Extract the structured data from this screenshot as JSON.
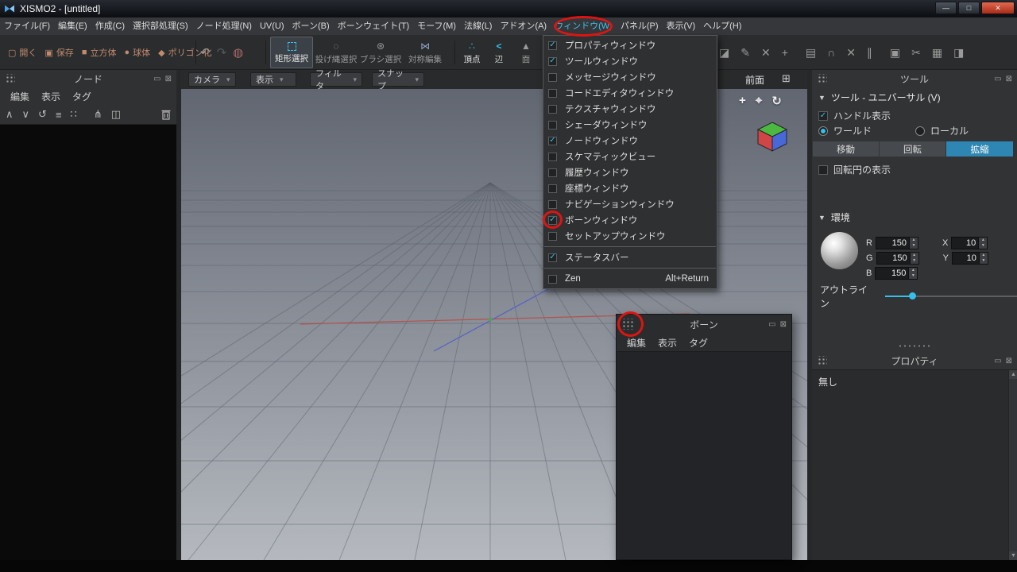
{
  "colors": {
    "accent": "#35c0ea",
    "annotation": "#dd1512"
  },
  "icons": {
    "open": "▢",
    "save": "▣",
    "cube": "■",
    "sphere": "●",
    "polygonize": "◆",
    "undo": "↶",
    "redo": "↷",
    "palette": "◍",
    "lasso": "◌",
    "brush": "⊛",
    "symmetry": "⋈",
    "vertex": "∴",
    "edge": "<",
    "face": "▲",
    "eraser": "◪",
    "pencil": "✎",
    "cross": "✕",
    "merge": "+",
    "document": "▤",
    "magnet": "∩",
    "remove": "✕",
    "mirror": "∥",
    "lock": "▣",
    "knife": "✂",
    "image": "▦",
    "stamp": "◨",
    "chevron": "▾",
    "section": "▼",
    "up": "∧",
    "down": "∨",
    "refresh": "↺",
    "list": "≡",
    "grid": "∷",
    "hierarchy": "⋔",
    "box": "◫",
    "win_min": "—",
    "win_max": "□",
    "win_close": "✕",
    "panel_min": "▭",
    "panel_close": "⊠",
    "pan": "+",
    "magnify": "⌖",
    "orbit": "↻",
    "projection": "⊞",
    "spin_up": "▲",
    "spin_down": "▼",
    "check": "✓"
  },
  "window": {
    "title": "XISMO2 - [untitled]"
  },
  "menubar": {
    "items": [
      {
        "label": "ファイル(F)"
      },
      {
        "label": "編集(E)"
      },
      {
        "label": "作成(C)"
      },
      {
        "label": "選択部処理(S)"
      },
      {
        "label": "ノード処理(N)"
      },
      {
        "label": "UV(U)"
      },
      {
        "label": "ボーン(B)"
      },
      {
        "label": "ボーンウェイト(T)"
      },
      {
        "label": "モーフ(M)"
      },
      {
        "label": "法線(L)"
      },
      {
        "label": "アドオン(A)"
      },
      {
        "label": "ウィンドウ(W)",
        "active": true
      },
      {
        "label": "パネル(P)"
      },
      {
        "label": "表示(V)"
      },
      {
        "label": "ヘルプ(H)"
      }
    ]
  },
  "toolbar": {
    "file_buttons": [
      {
        "label": "開く"
      },
      {
        "label": "保存"
      },
      {
        "label": "立方体"
      },
      {
        "label": "球体"
      },
      {
        "label": "ポリゴン化"
      }
    ],
    "select_buttons": [
      {
        "label": "矩形選択",
        "active": true
      },
      {
        "label": "投げ縄選択",
        "active": false
      },
      {
        "label": "ブラシ選択",
        "active": false
      },
      {
        "label": "対称編集",
        "active": false
      }
    ],
    "element_buttons": [
      {
        "label": "頂点",
        "active": true
      },
      {
        "label": "辺",
        "active": false
      },
      {
        "label": "面",
        "active": false
      }
    ]
  },
  "window_menu": {
    "items": [
      {
        "label": "プロパティウィンドウ",
        "checked": true
      },
      {
        "label": "ツールウィンドウ",
        "checked": true
      },
      {
        "label": "メッセージウィンドウ",
        "checked": false
      },
      {
        "label": "コードエディタウィンドウ",
        "checked": false
      },
      {
        "label": "テクスチャウィンドウ",
        "checked": false
      },
      {
        "label": "シェーダウィンドウ",
        "checked": false
      },
      {
        "label": "ノードウィンドウ",
        "checked": true
      },
      {
        "label": "スケマティックビュー",
        "checked": false
      },
      {
        "label": "履歴ウィンドウ",
        "checked": false
      },
      {
        "label": "座標ウィンドウ",
        "checked": false
      },
      {
        "label": "ナビゲーションウィンドウ",
        "checked": false
      },
      {
        "label": "ボーンウィンドウ",
        "checked": true
      },
      {
        "label": "セットアップウィンドウ",
        "checked": false
      },
      {
        "label": "ステータスバー",
        "checked": true
      },
      {
        "label": "Zen",
        "checked": false,
        "shortcut": "Alt+Return"
      }
    ]
  },
  "node_panel": {
    "title": "ノード",
    "menu": [
      {
        "label": "編集"
      },
      {
        "label": "表示"
      },
      {
        "label": "タグ"
      }
    ]
  },
  "viewport": {
    "dropdowns": [
      {
        "label": "カメラ"
      },
      {
        "label": "表示"
      },
      {
        "label": "フィルタ"
      },
      {
        "label": "スナップ"
      }
    ],
    "view_label": "前面"
  },
  "tool_panel": {
    "title": "ツール",
    "section_tool": "ツール - ユニバーサル (V)",
    "handle_label": "ハンドル表示",
    "handle_checked": true,
    "world_label": "ワールド",
    "world_selected": true,
    "local_label": "ローカル",
    "local_selected": false,
    "transform_buttons": [
      {
        "label": "移動",
        "active": false
      },
      {
        "label": "回転",
        "active": false
      },
      {
        "label": "拡縮",
        "active": true
      }
    ],
    "rotation_circle_label": "回転円の表示",
    "rotation_circle_checked": false,
    "section_env": "環境",
    "env_rows": [
      {
        "label": "R",
        "value": "150",
        "pair_label": "X",
        "pair_value": "10"
      },
      {
        "label": "G",
        "value": "150",
        "pair_label": "Y",
        "pair_value": "10"
      },
      {
        "label": "B",
        "value": "150"
      }
    ],
    "outline_label": "アウトライン"
  },
  "property_panel": {
    "title": "プロパティ",
    "empty_text": "無し"
  },
  "bone_window": {
    "title": "ボーン",
    "menu": [
      {
        "label": "編集"
      },
      {
        "label": "表示"
      },
      {
        "label": "タグ"
      }
    ]
  }
}
